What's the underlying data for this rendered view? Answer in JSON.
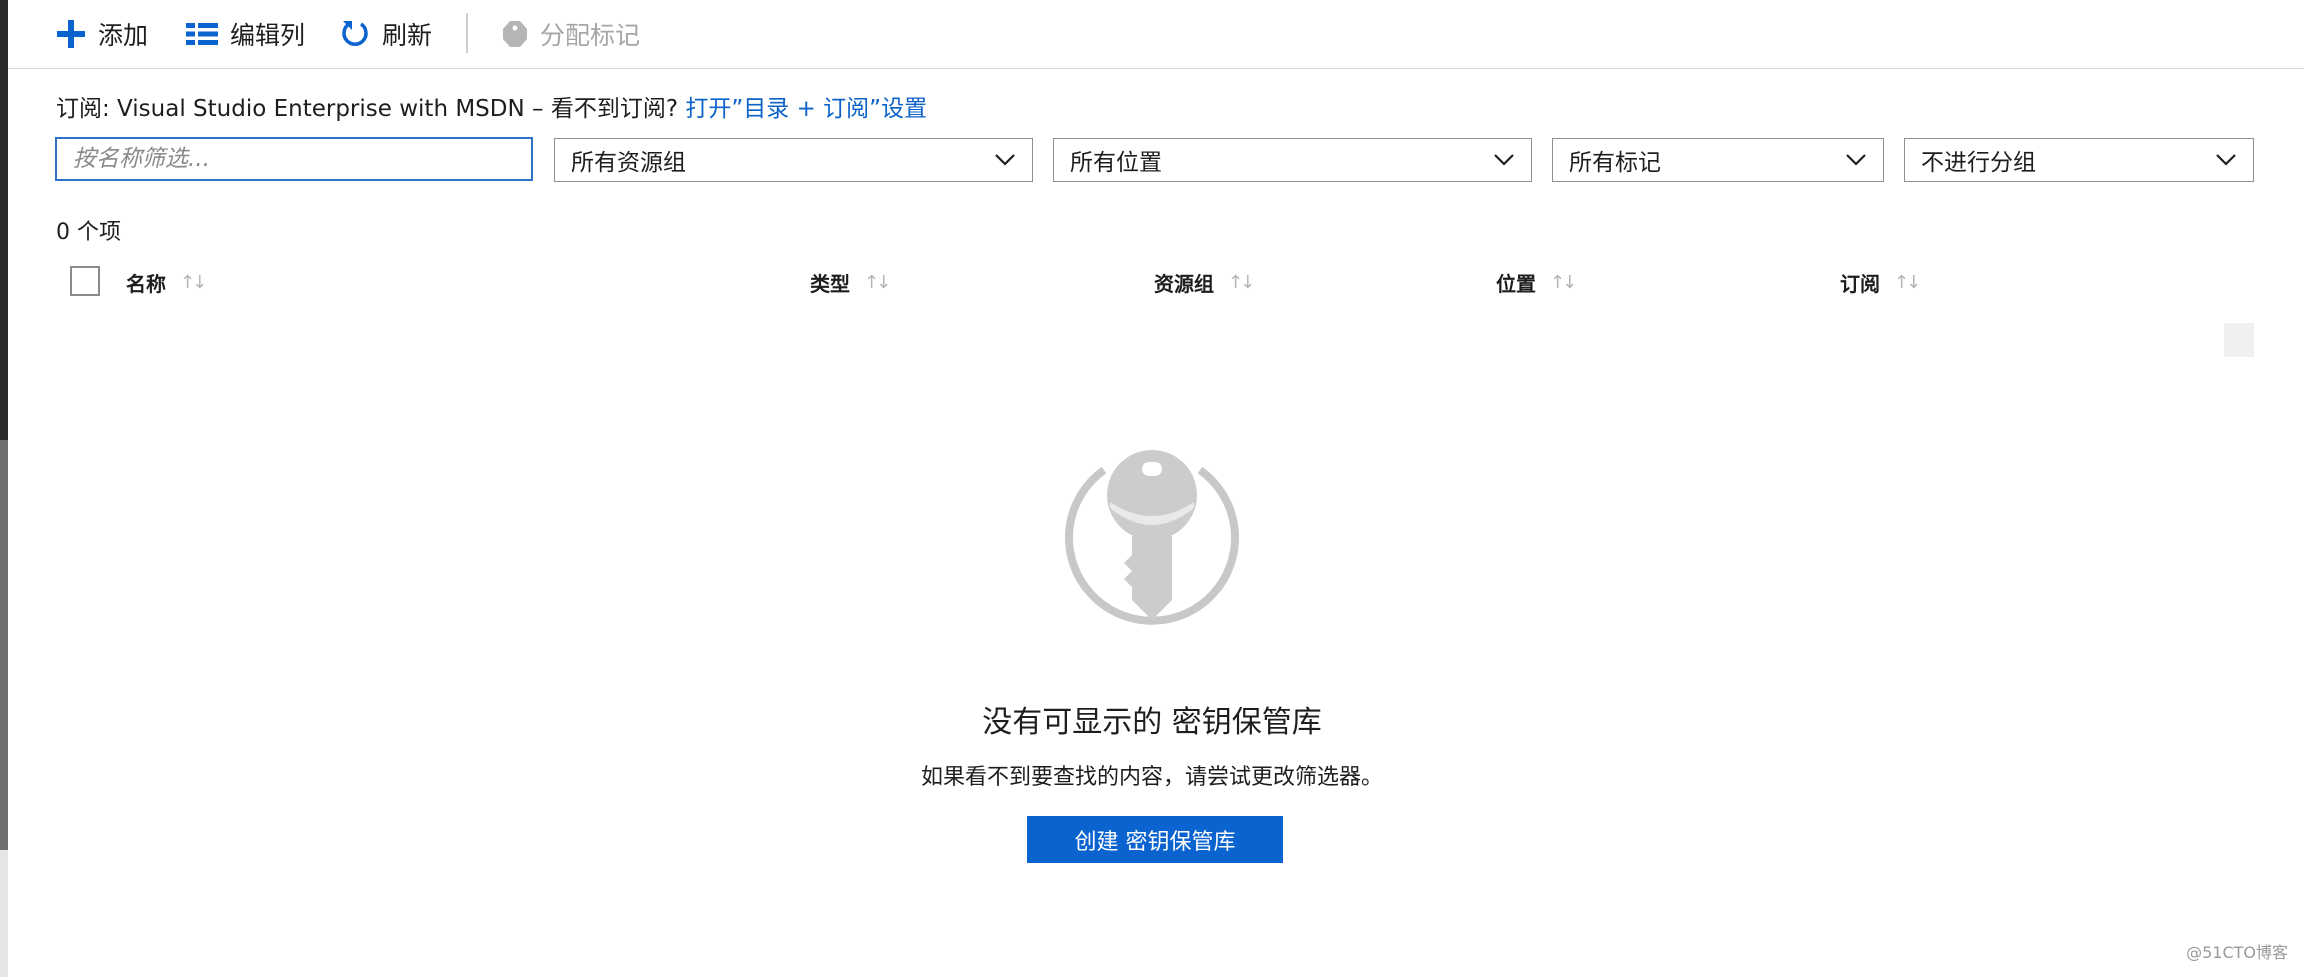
{
  "toolbar": {
    "add_label": "添加",
    "edit_columns_label": "编辑列",
    "refresh_label": "刷新",
    "assign_tags_label": "分配标记"
  },
  "subscription": {
    "prefix": "订阅: Visual Studio Enterprise with MSDN – 看不到订阅?",
    "link": "打开”目录 + 订阅”设置"
  },
  "filters": {
    "name_placeholder": "按名称筛选...",
    "resource_group": "所有资源组",
    "location": "所有位置",
    "tags": "所有标记",
    "grouping": "不进行分组"
  },
  "item_count": "0 个项",
  "table": {
    "columns": [
      "名称",
      "类型",
      "资源组",
      "位置",
      "订阅"
    ],
    "sort_glyph": "↑↓"
  },
  "empty_state": {
    "title": "没有可显示的 密钥保管库",
    "subtitle": "如果看不到要查找的内容，请尝试更改筛选器。",
    "button": "创建 密钥保管库"
  },
  "watermark": "@51CTO博客",
  "colors": {
    "accent": "#0a63cf",
    "link": "#0b62c9",
    "icon_gray": "#c8c8c8"
  }
}
